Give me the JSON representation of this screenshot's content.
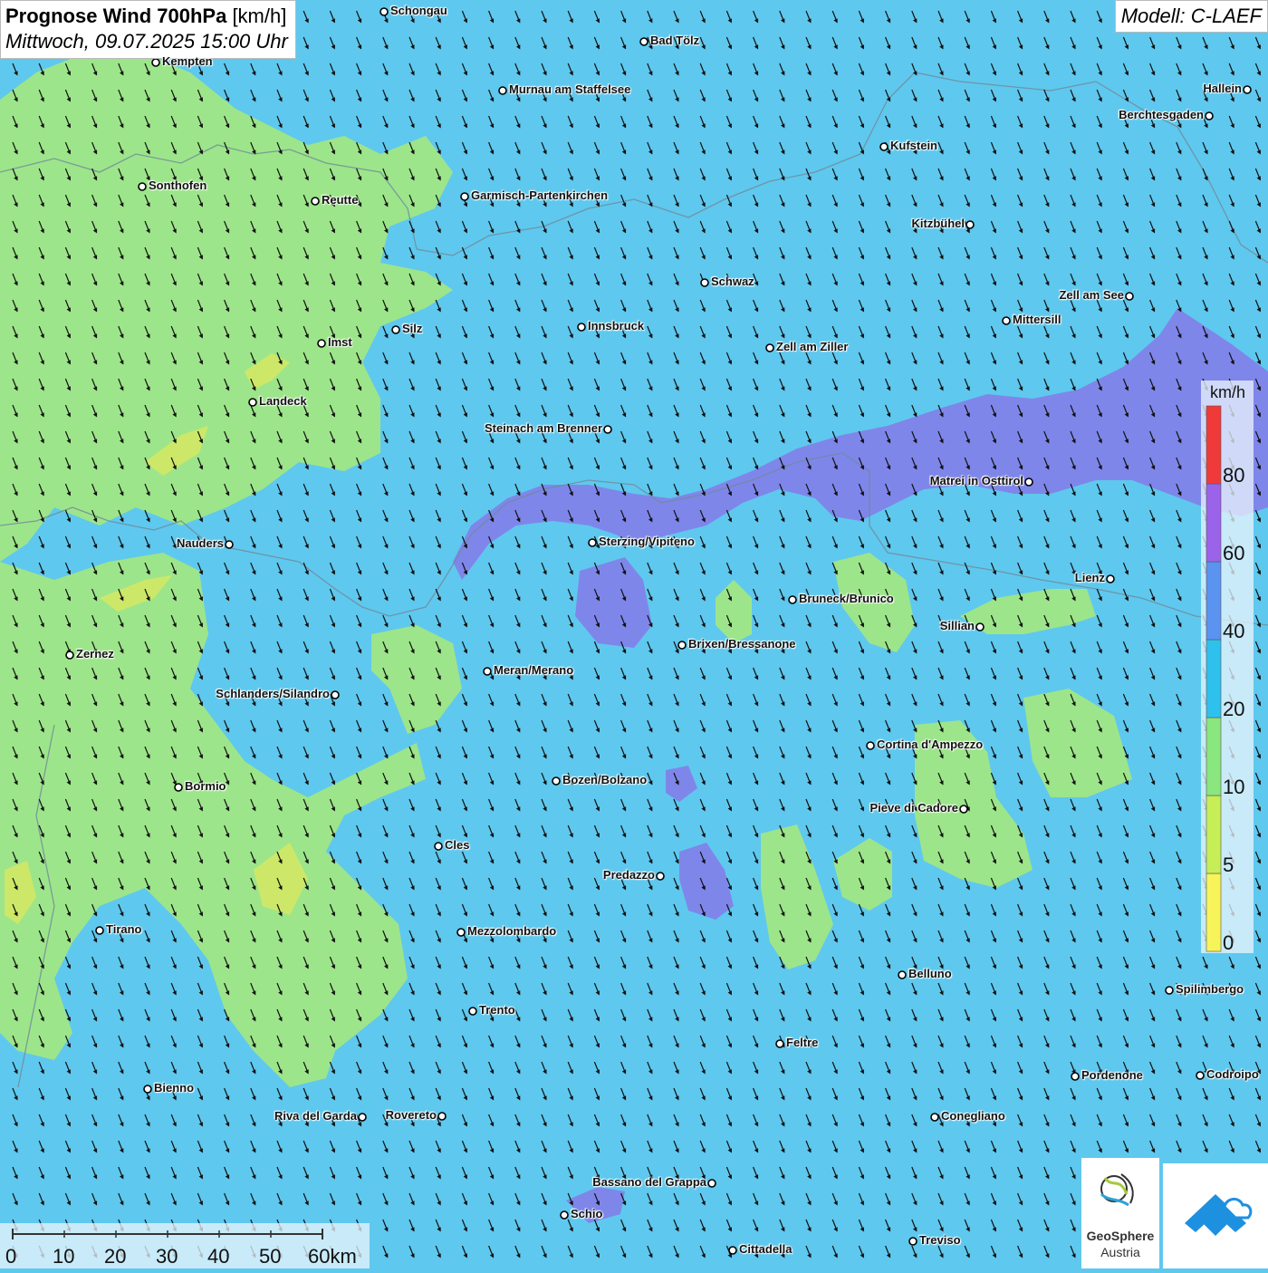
{
  "header": {
    "title_bold": "Prognose Wind 700hPa",
    "title_unit": "[km/h]",
    "datetime": "Mittwoch, 09.07.2025 15:00 Uhr",
    "model": "Modell: C-LAEF"
  },
  "legend": {
    "unit": "km/h",
    "ticks": [
      "0",
      "5",
      "10",
      "20",
      "40",
      "60",
      "80"
    ],
    "colors": [
      "#f7f45a",
      "#c6ee57",
      "#8ae67e",
      "#2fc1ee",
      "#5a93f0",
      "#9b63ea",
      "#f03a3a"
    ]
  },
  "scale_bar": {
    "labels": [
      "0",
      "10",
      "20",
      "30",
      "40",
      "50",
      "60km"
    ]
  },
  "logos": {
    "geosphere_line1": "GeoSphere",
    "geosphere_line2": "Austria"
  },
  "colors": {
    "base_wind": "#5fc8ee",
    "green_zone": "#9de58a",
    "purple_zone": "#7f86ea",
    "yellow_zone": "#cde868"
  },
  "cities": [
    {
      "name": "Schongau"
    },
    {
      "name": "Kempten"
    },
    {
      "name": "Bad Tölz"
    },
    {
      "name": "Murnau am Staffelsee"
    },
    {
      "name": "Hallein"
    },
    {
      "name": "Berchtesgaden"
    },
    {
      "name": "Kufstein"
    },
    {
      "name": "Sonthofen"
    },
    {
      "name": "Reutte"
    },
    {
      "name": "Garmisch-Partenkirchen"
    },
    {
      "name": "Kitzbühel"
    },
    {
      "name": "Schwaz"
    },
    {
      "name": "Zell am See"
    },
    {
      "name": "Mittersill"
    },
    {
      "name": "Innsbruck"
    },
    {
      "name": "Silz"
    },
    {
      "name": "Imst"
    },
    {
      "name": "Zell am Ziller"
    },
    {
      "name": "Landeck"
    },
    {
      "name": "Steinach am Brenner"
    },
    {
      "name": "Matrei in Osttirol"
    },
    {
      "name": "Nauders"
    },
    {
      "name": "Sterzing/Vipiteno"
    },
    {
      "name": "Lienz"
    },
    {
      "name": "Bruneck/Brunico"
    },
    {
      "name": "Sillian"
    },
    {
      "name": "Zernez"
    },
    {
      "name": "Brixen/Bressanone"
    },
    {
      "name": "Meran/Merano"
    },
    {
      "name": "Schlanders/Silandro"
    },
    {
      "name": "Cortina d'Ampezzo"
    },
    {
      "name": "Bormio"
    },
    {
      "name": "Bozen/Bolzano"
    },
    {
      "name": "Pieve di Cadore"
    },
    {
      "name": "Cles"
    },
    {
      "name": "Predazzo"
    },
    {
      "name": "Tirano"
    },
    {
      "name": "Mezzolombardo"
    },
    {
      "name": "Belluno"
    },
    {
      "name": "Spilimbergo"
    },
    {
      "name": "Trento"
    },
    {
      "name": "Feltre"
    },
    {
      "name": "Bienno"
    },
    {
      "name": "Pordenone"
    },
    {
      "name": "Codroipo"
    },
    {
      "name": "Riva del Garda"
    },
    {
      "name": "Rovereto"
    },
    {
      "name": "Conegliano"
    },
    {
      "name": "Bassano del Grappa"
    },
    {
      "name": "Schio"
    },
    {
      "name": "Treviso"
    },
    {
      "name": "Cittadella"
    }
  ]
}
